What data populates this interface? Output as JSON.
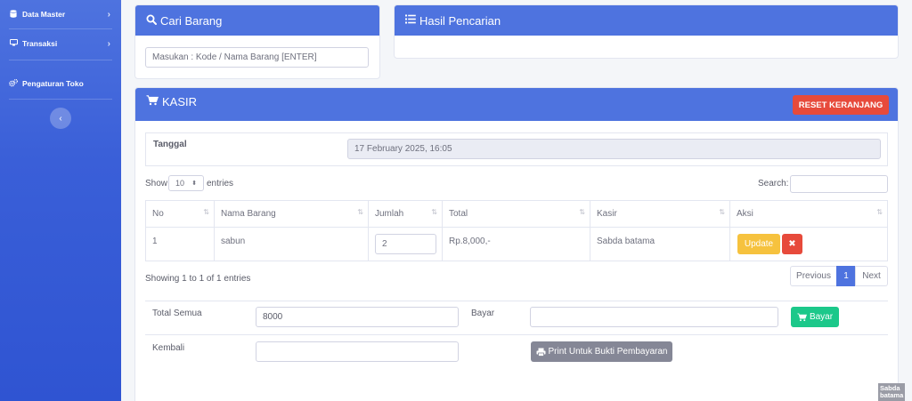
{
  "sidebar": {
    "items": [
      {
        "label": "Data Master",
        "icon": "database-icon"
      },
      {
        "label": "Transaksi",
        "icon": "desktop-icon"
      },
      {
        "label": "Pengaturan Toko",
        "icon": "cogs-icon"
      }
    ],
    "toggle_glyph": "‹"
  },
  "search_card": {
    "title": "Cari Barang",
    "placeholder": "Masukan : Kode / Nama Barang  [ENTER]"
  },
  "result_card": {
    "title": "Hasil Pencarian"
  },
  "kasir": {
    "title": "KASIR",
    "reset_label": "RESET KERANJANG",
    "tanggal_label": "Tanggal",
    "tanggal_value": "17 February 2025, 16:05",
    "show_label": "Show",
    "entries_value": "10",
    "entries_label": "entries",
    "search_label": "Search:",
    "columns": [
      "No",
      "Nama Barang",
      "Jumlah",
      "Total",
      "Kasir",
      "Aksi"
    ],
    "rows": [
      {
        "no": "1",
        "nama": "sabun",
        "jumlah": "2",
        "total": "Rp.8,000,-",
        "kasir": "Sabda batama"
      }
    ],
    "update_label": "Update",
    "delete_glyph": "✖",
    "showing_text": "Showing 1 to 1 of 1 entries",
    "pager": {
      "previous": "Previous",
      "current": "1",
      "next": "Next"
    },
    "total_semua_label": "Total Semua",
    "total_semua_value": "8000",
    "bayar_label": "Bayar",
    "bayar_button": "Bayar",
    "kembali_label": "Kembali",
    "print_button": "Print Untuk Bukti Pembayaran"
  },
  "watermark": {
    "text": "Sabda batama"
  },
  "colors": {
    "primary": "#4e73df",
    "danger": "#e74a3b",
    "warning": "#f6c23e",
    "success": "#1cc88a",
    "secondary": "#858796"
  }
}
